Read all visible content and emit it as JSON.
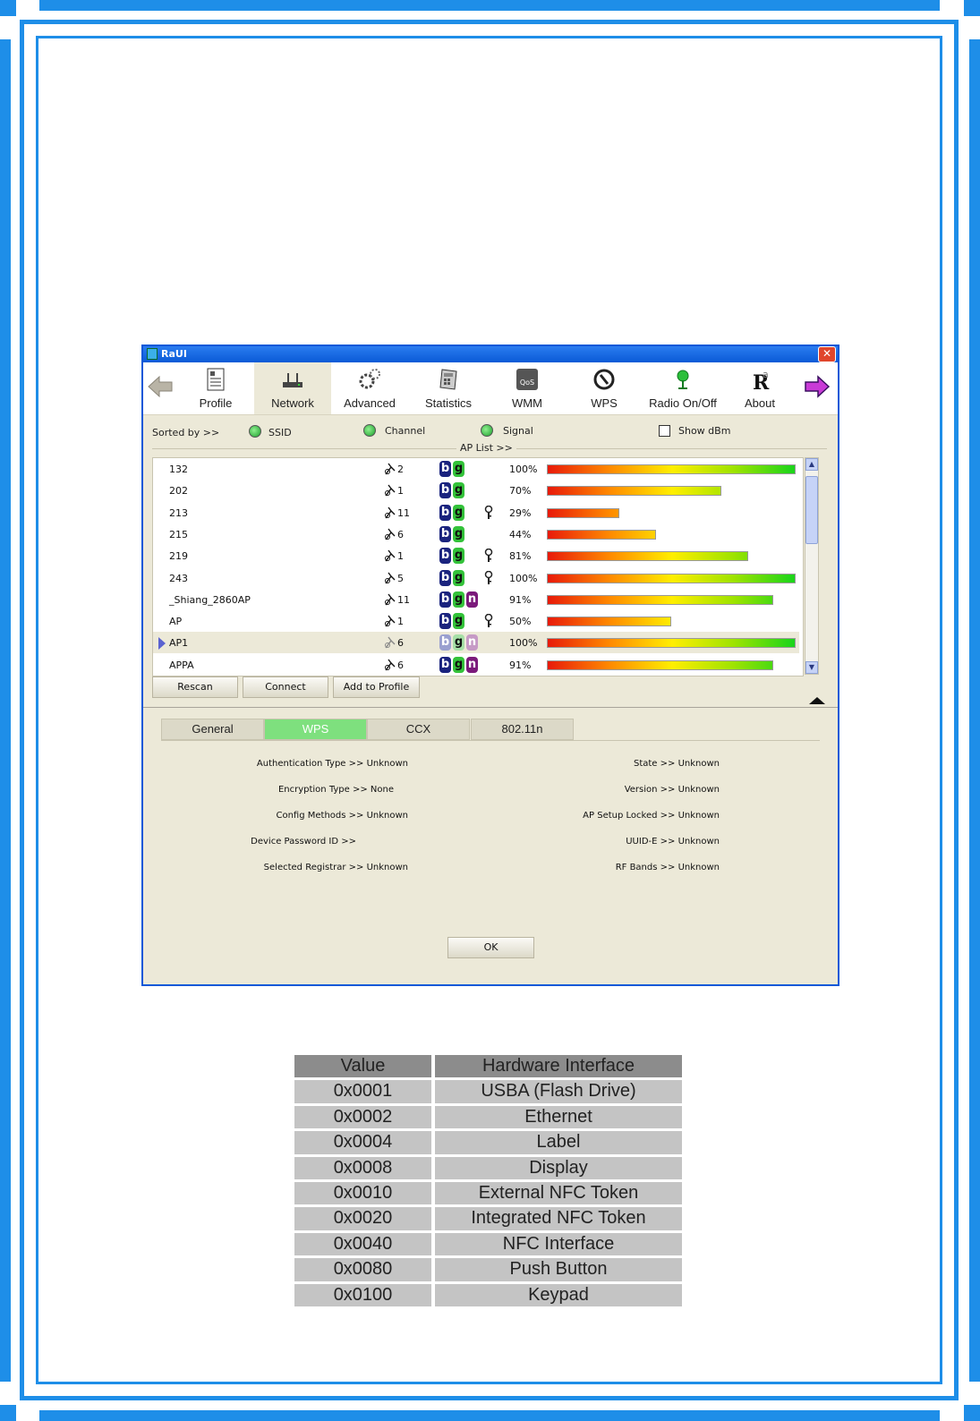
{
  "window": {
    "title": "RaUI",
    "close_glyph": "✕"
  },
  "toolbar": {
    "items": [
      {
        "label": "Profile",
        "icon": "profile-icon"
      },
      {
        "label": "Network",
        "icon": "network-icon"
      },
      {
        "label": "Advanced",
        "icon": "advanced-icon"
      },
      {
        "label": "Statistics",
        "icon": "statistics-icon"
      },
      {
        "label": "WMM",
        "icon": "wmm-icon"
      },
      {
        "label": "WPS",
        "icon": "wps-icon"
      },
      {
        "label": "Radio On/Off",
        "icon": "radio-icon"
      },
      {
        "label": "About",
        "icon": "about-icon"
      }
    ],
    "active": "Network"
  },
  "sort": {
    "label": "Sorted by >>",
    "ssid": "SSID",
    "channel": "Channel",
    "signal": "Signal",
    "show_dbm": "Show dBm"
  },
  "ap_list": {
    "title": "AP List >>",
    "rows": [
      {
        "ssid": "132",
        "channel": "2",
        "modes": [
          "b",
          "g"
        ],
        "secured": false,
        "signal": "100%",
        "signal_pct": 100,
        "selected": false
      },
      {
        "ssid": "202",
        "channel": "1",
        "modes": [
          "b",
          "g"
        ],
        "secured": false,
        "signal": "70%",
        "signal_pct": 70,
        "selected": false
      },
      {
        "ssid": "213",
        "channel": "11",
        "modes": [
          "b",
          "g"
        ],
        "secured": true,
        "signal": "29%",
        "signal_pct": 29,
        "selected": false
      },
      {
        "ssid": "215",
        "channel": "6",
        "modes": [
          "b",
          "g"
        ],
        "secured": false,
        "signal": "44%",
        "signal_pct": 44,
        "selected": false
      },
      {
        "ssid": "219",
        "channel": "1",
        "modes": [
          "b",
          "g"
        ],
        "secured": true,
        "signal": "81%",
        "signal_pct": 81,
        "selected": false
      },
      {
        "ssid": "243",
        "channel": "5",
        "modes": [
          "b",
          "g"
        ],
        "secured": true,
        "signal": "100%",
        "signal_pct": 100,
        "selected": false
      },
      {
        "ssid": "_Shiang_2860AP",
        "channel": "11",
        "modes": [
          "b",
          "g",
          "n"
        ],
        "secured": false,
        "signal": "91%",
        "signal_pct": 91,
        "selected": false
      },
      {
        "ssid": "AP",
        "channel": "1",
        "modes": [
          "b",
          "g"
        ],
        "secured": true,
        "signal": "50%",
        "signal_pct": 50,
        "selected": false
      },
      {
        "ssid": "AP1",
        "channel": "6",
        "modes": [
          "b",
          "g",
          "n"
        ],
        "secured": false,
        "signal": "100%",
        "signal_pct": 100,
        "selected": true
      },
      {
        "ssid": "APPA",
        "channel": "6",
        "modes": [
          "b",
          "g",
          "n"
        ],
        "secured": false,
        "signal": "91%",
        "signal_pct": 91,
        "selected": false
      }
    ]
  },
  "buttons": {
    "rescan": "Rescan",
    "connect": "Connect",
    "add_to_profile": "Add to Profile",
    "ok": "OK"
  },
  "tabs": [
    "General",
    "WPS",
    "CCX",
    "802.11n"
  ],
  "active_tab": "WPS",
  "wps_info": {
    "left": [
      "Authentication Type >> Unknown",
      "Encryption Type >> None",
      "Config Methods >> Unknown",
      "Device Password ID >>",
      "Selected Registrar >> Unknown"
    ],
    "right": [
      "State >> Unknown",
      "Version >> Unknown",
      "AP Setup Locked >> Unknown",
      "UUID-E >> Unknown",
      "RF Bands >> Unknown"
    ]
  },
  "hw_table": {
    "headers": [
      "Value",
      "Hardware Interface"
    ],
    "rows": [
      [
        "0x0001",
        "USBA (Flash Drive)"
      ],
      [
        "0x0002",
        "Ethernet"
      ],
      [
        "0x0004",
        "Label"
      ],
      [
        "0x0008",
        "Display"
      ],
      [
        "0x0010",
        "External NFC Token"
      ],
      [
        "0x0020",
        "Integrated NFC Token"
      ],
      [
        "0x0040",
        "NFC Interface"
      ],
      [
        "0x0080",
        "Push Button"
      ],
      [
        "0x0100",
        "Keypad"
      ]
    ]
  },
  "colors": {
    "frame": "#1e8ee8",
    "window_bg": "#ece9d8",
    "titlebar": "#0a5ad6",
    "active_tab": "#7ee07e",
    "table_header": "#8c8c8c",
    "table_cell": "#c4c4c4"
  }
}
